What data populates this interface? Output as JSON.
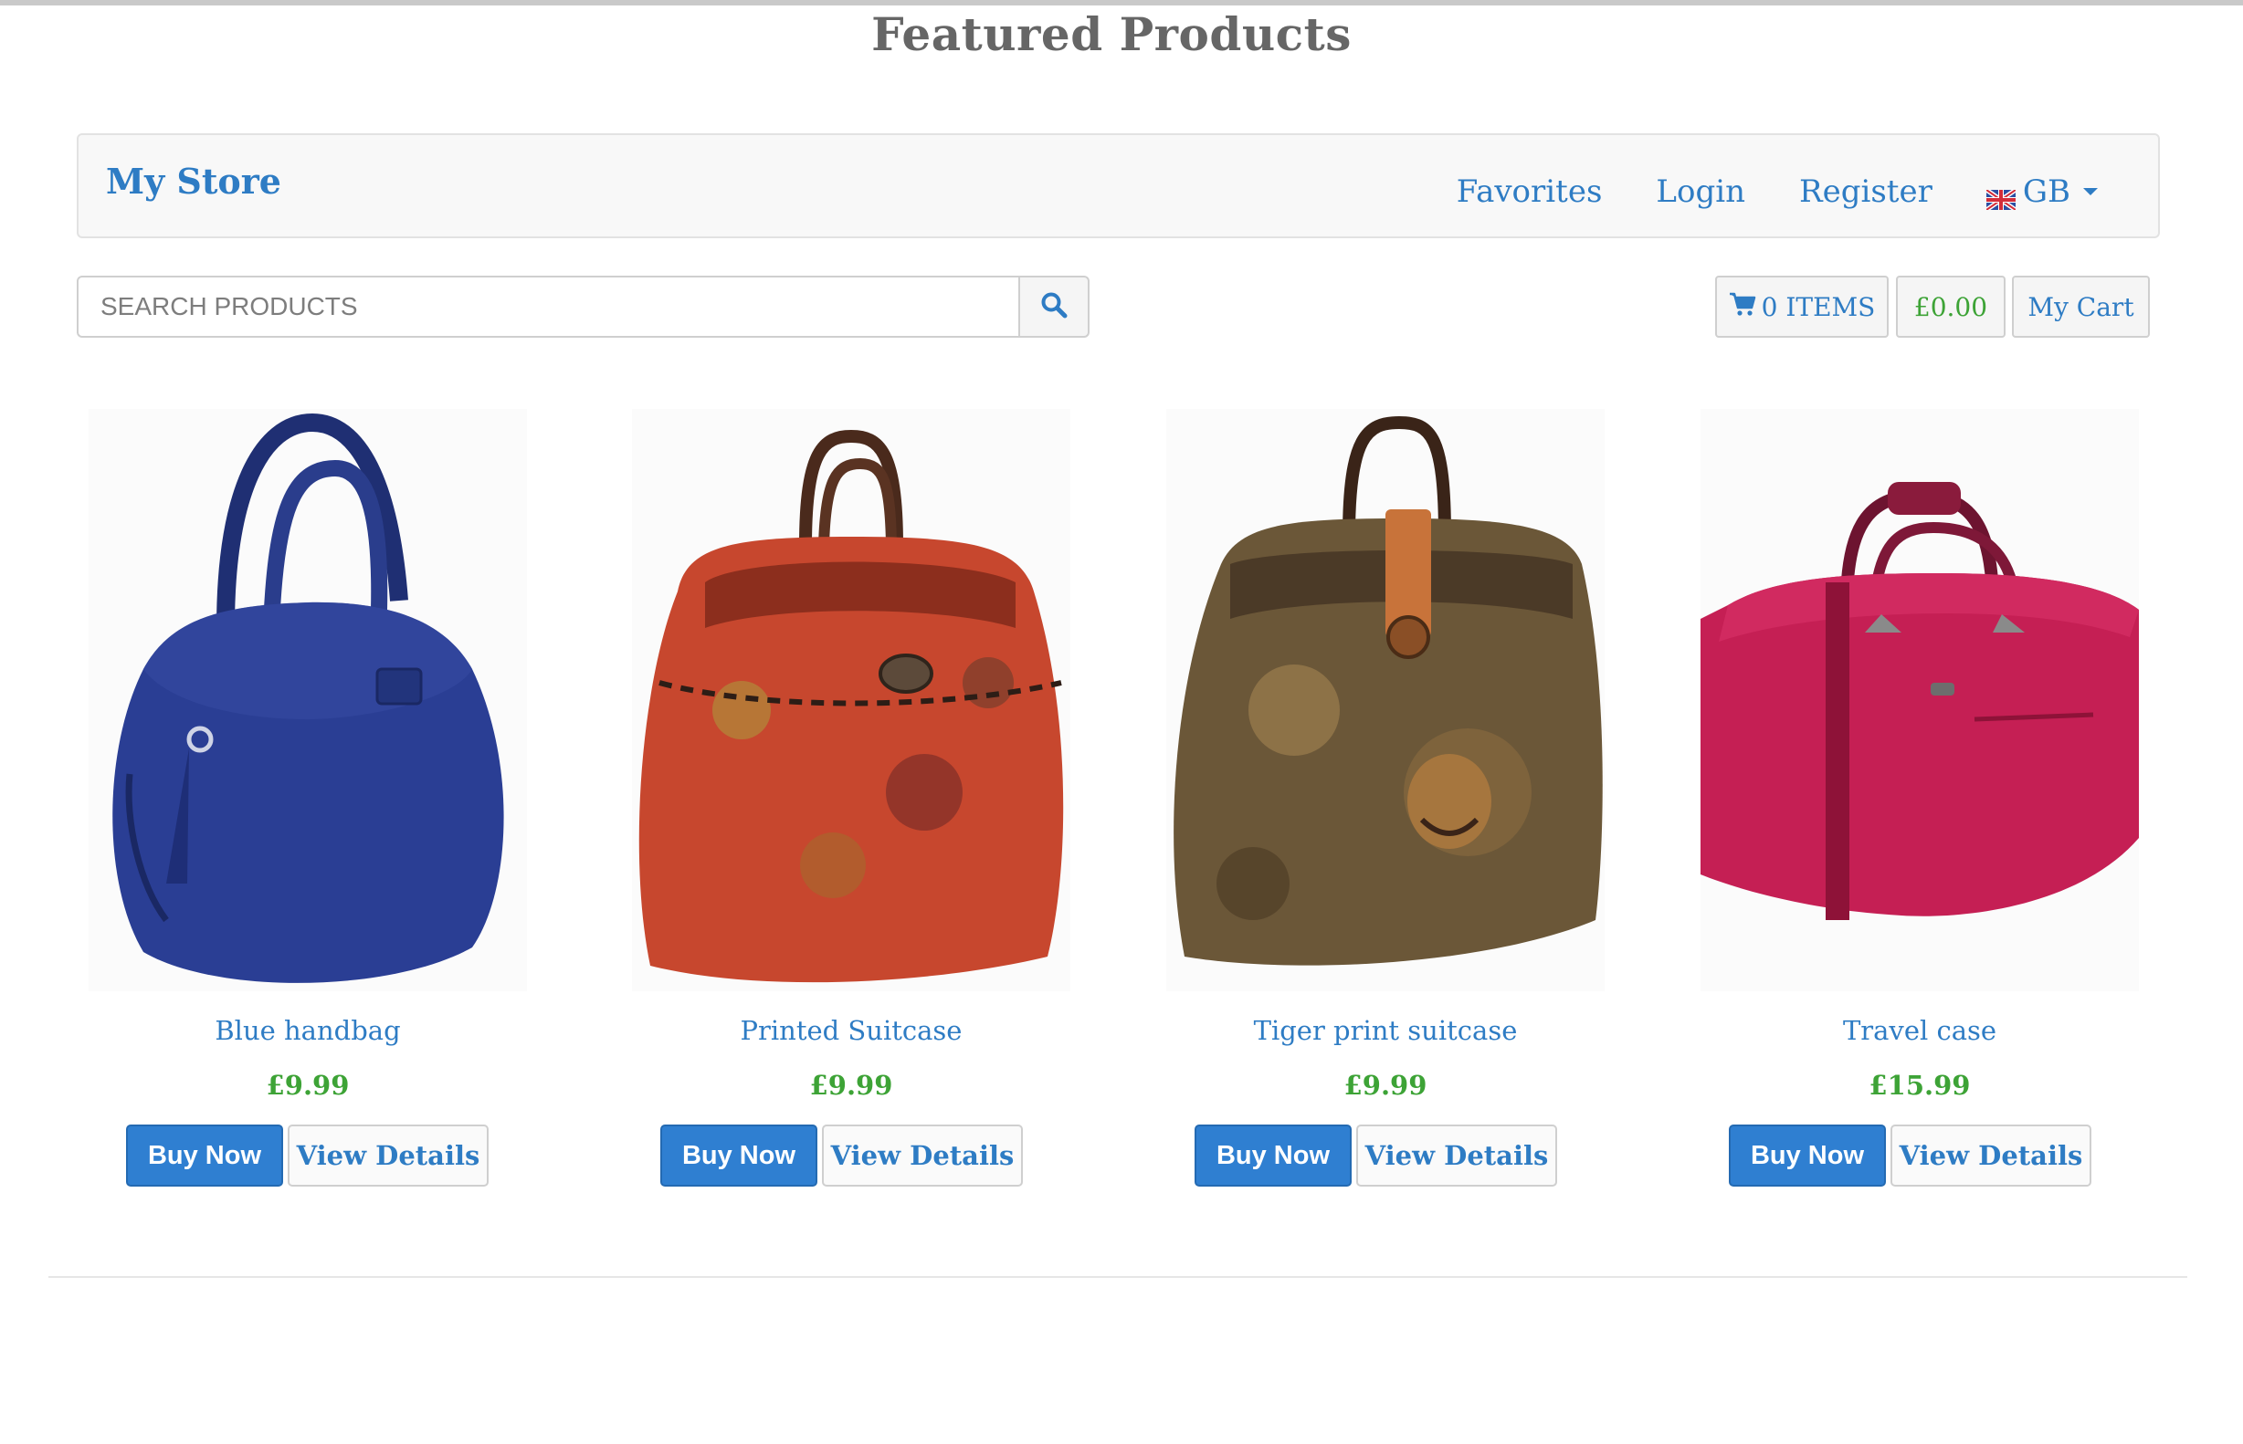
{
  "page": {
    "heading": "Featured Products"
  },
  "navbar": {
    "brand": "My Store",
    "links": {
      "favorites": "Favorites",
      "login": "Login",
      "register": "Register",
      "locale": "GB"
    }
  },
  "search": {
    "placeholder": "SEARCH PRODUCTS",
    "value": ""
  },
  "cart": {
    "items_label": "0 ITEMS",
    "total": "£0.00",
    "my_cart_label": "My Cart"
  },
  "products": [
    {
      "name": "Blue handbag",
      "price": "£9.99",
      "buy_label": "Buy Now",
      "details_label": "View Details",
      "image": "blue-handbag"
    },
    {
      "name": "Printed Suitcase",
      "price": "£9.99",
      "buy_label": "Buy Now",
      "details_label": "View Details",
      "image": "printed-suitcase"
    },
    {
      "name": "Tiger print suitcase",
      "price": "£9.99",
      "buy_label": "Buy Now",
      "details_label": "View Details",
      "image": "tiger-print-suitcase"
    },
    {
      "name": "Travel case",
      "price": "£15.99",
      "buy_label": "Buy Now",
      "details_label": "View Details",
      "image": "travel-case"
    }
  ],
  "colors": {
    "link": "#2e7cc4",
    "price": "#3da336",
    "primary_button": "#2f7fd1"
  },
  "icons": {
    "search": "search-icon",
    "cart": "cart-icon",
    "flag": "gb-flag-icon",
    "dropdown": "caret-down-icon"
  }
}
